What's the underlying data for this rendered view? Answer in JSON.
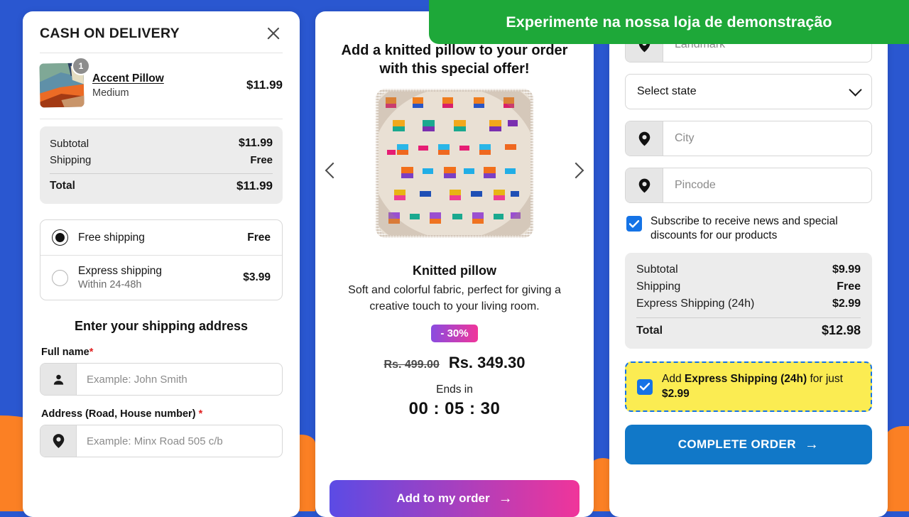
{
  "promo_banner": {
    "text": "Experimente na nossa loja de demonstração",
    "bg_color": "#1ea839"
  },
  "background": {
    "blue": "#2a57d0",
    "orange": "#fb8024"
  },
  "left_card": {
    "title": "CASH ON DELIVERY",
    "close_label": "×",
    "product": {
      "name": "Accent Pillow",
      "variant": "Medium",
      "price": "$11.99",
      "quantity": "1"
    },
    "totals": [
      {
        "label": "Subtotal",
        "value": "$11.99"
      },
      {
        "label": "Shipping",
        "value": "Free"
      }
    ],
    "total": {
      "label": "Total",
      "value": "$11.99"
    },
    "shipping_options": [
      {
        "name": "Free shipping",
        "sub": "",
        "price": "Free",
        "selected": true
      },
      {
        "name": "Express shipping",
        "sub": "Within 24-48h",
        "price": "$3.99",
        "selected": false
      }
    ],
    "address_heading": "Enter your shipping address",
    "fields": [
      {
        "label": "Full name",
        "required": "*",
        "placeholder": "Example: John Smith",
        "icon": "person-icon"
      },
      {
        "label": "Address (Road, House number)",
        "required": "*",
        "placeholder": "Example: Minx Road 505 c/b",
        "icon": "map-pin-icon"
      }
    ]
  },
  "center_card": {
    "headline": "Add a knitted pillow to your order with this special offer!",
    "product_name": "Knitted pillow",
    "description": "Soft and colorful fabric, perfect for giving a creative touch to your living room.",
    "discount_badge": "- 30%",
    "price_old": "Rs. 499.00",
    "price_new": "Rs. 349.30",
    "ends_in_label": "Ends in",
    "countdown": "00 : 05 : 30",
    "cta_label": "Add to my order",
    "cta_arrow": "→",
    "prev_label": "‹",
    "next_label": "›"
  },
  "right_card": {
    "landmark": {
      "placeholder": "Landmark",
      "icon": "map-pin-icon"
    },
    "state_select": {
      "value": "Select state"
    },
    "city": {
      "placeholder": "City",
      "icon": "map-pin-icon"
    },
    "pincode": {
      "placeholder": "Pincode",
      "icon": "map-pin-icon"
    },
    "subscribe": {
      "label": "Subscribe to receive news and special discounts for our products",
      "checked": true
    },
    "totals": [
      {
        "label": "Subtotal",
        "value": "$9.99"
      },
      {
        "label": "Shipping",
        "value": "Free"
      },
      {
        "label": "Express Shipping (24h)",
        "value": "$2.99"
      }
    ],
    "total": {
      "label": "Total",
      "value": "$12.98"
    },
    "upsell": {
      "prefix": "Add ",
      "bold1": "Express Shipping (24h)",
      "middle": " for just ",
      "bold2": "$2.99",
      "checked": true,
      "bg_color": "#fbec52",
      "border_color": "#1573e6"
    },
    "cta_label": "COMPLETE ORDER",
    "cta_arrow": "→",
    "cta_color": "#1178c8"
  }
}
